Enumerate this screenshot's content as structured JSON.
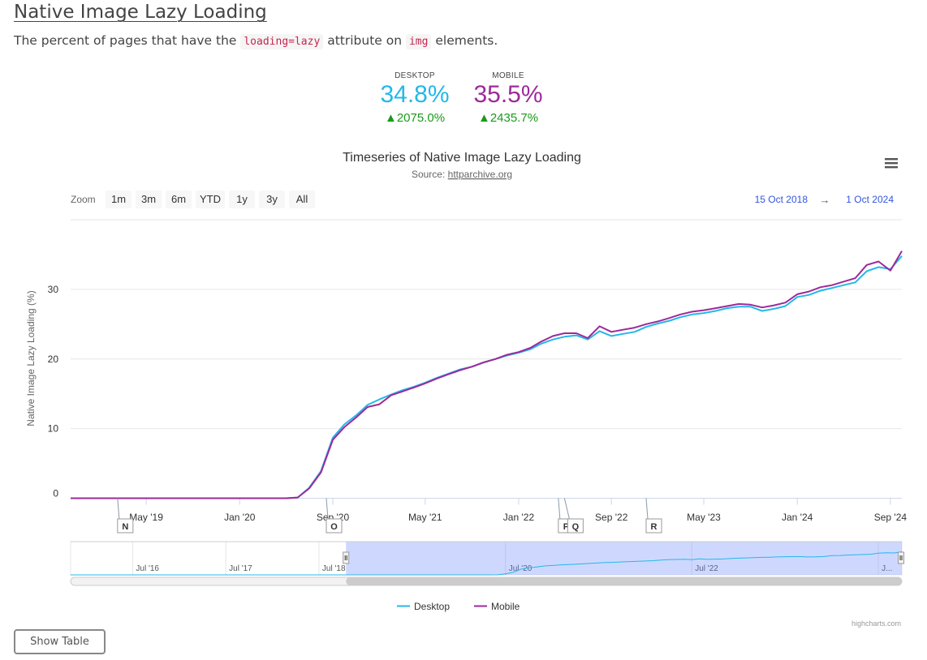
{
  "page": {
    "title": "Native Image Lazy Loading",
    "description_before": "The percent of pages that have the ",
    "description_code1": "loading=lazy",
    "description_middle": " attribute on ",
    "description_code2": "img",
    "description_after": " elements."
  },
  "summary": {
    "desktop": {
      "label": "DESKTOP",
      "value": "34.8%",
      "change": "▲2075.0%",
      "color": "#24b8e8"
    },
    "mobile": {
      "label": "MOBILE",
      "value": "35.5%",
      "change": "▲2435.7%",
      "color": "#9c2a9a"
    }
  },
  "zoom": {
    "label": "Zoom",
    "buttons": [
      "1m",
      "3m",
      "6m",
      "YTD",
      "1y",
      "3y",
      "All"
    ],
    "from": "15 Oct 2018",
    "arrow": "→",
    "to": "1 Oct 2024"
  },
  "menu_icon": "hamburger-menu-icon",
  "show_table_label": "Show Table",
  "credits": "highcharts.com",
  "chart_data": {
    "type": "line",
    "title": "Timeseries of Native Image Lazy Loading",
    "subtitle_prefix": "Source: ",
    "subtitle_link": "httparchive.org",
    "ylabel": "Native Image Lazy Loading (%)",
    "xlabel": "",
    "ylim": [
      0,
      40
    ],
    "xlim": [
      "2018-10-15",
      "2024-10-01"
    ],
    "y_ticks": [
      0,
      10,
      20,
      30
    ],
    "x_ticks": [
      {
        "date": "2019-05-01",
        "label": "May '19"
      },
      {
        "date": "2020-01-01",
        "label": "Jan '20"
      },
      {
        "date": "2020-09-01",
        "label": "Sep '20"
      },
      {
        "date": "2021-05-01",
        "label": "May '21"
      },
      {
        "date": "2022-01-01",
        "label": "Jan '22"
      },
      {
        "date": "2022-09-01",
        "label": "Sep '22"
      },
      {
        "date": "2023-05-01",
        "label": "May '23"
      },
      {
        "date": "2024-01-01",
        "label": "Jan '24"
      },
      {
        "date": "2024-09-01",
        "label": "Sep '24"
      }
    ],
    "grid": true,
    "legend": "bottom-center",
    "flags": [
      {
        "date": "2019-02-15",
        "label": "N"
      },
      {
        "date": "2020-08-15",
        "label": "O"
      },
      {
        "date": "2022-04-15",
        "label": "P"
      },
      {
        "date": "2022-05-01",
        "label": "Q"
      },
      {
        "date": "2022-12-01",
        "label": "R"
      }
    ],
    "navigator": {
      "range": [
        "2015-11-01",
        "2024-10-01"
      ],
      "selected": [
        "2018-10-15",
        "2024-10-01"
      ],
      "labels": [
        {
          "date": "2016-07-01",
          "label": "Jul '16"
        },
        {
          "date": "2017-07-01",
          "label": "Jul '17"
        },
        {
          "date": "2018-07-01",
          "label": "Jul '18"
        },
        {
          "date": "2020-07-01",
          "label": "Jul '20"
        },
        {
          "date": "2022-07-01",
          "label": "Jul '22"
        },
        {
          "date": "2024-07-01",
          "label": "J..."
        }
      ]
    },
    "series": [
      {
        "name": "Desktop",
        "color": "#24b8e8",
        "points": [
          [
            "2018-10-15",
            0
          ],
          [
            "2019-03-01",
            0
          ],
          [
            "2019-08-01",
            0
          ],
          [
            "2020-01-01",
            0
          ],
          [
            "2020-05-01",
            0
          ],
          [
            "2020-06-01",
            0.1
          ],
          [
            "2020-07-01",
            1.5
          ],
          [
            "2020-08-01",
            3.9
          ],
          [
            "2020-09-01",
            8.7
          ],
          [
            "2020-10-01",
            10.6
          ],
          [
            "2020-11-01",
            11.9
          ],
          [
            "2020-12-01",
            13.4
          ],
          [
            "2021-01-01",
            14.2
          ],
          [
            "2021-02-01",
            14.9
          ],
          [
            "2021-03-01",
            15.5
          ],
          [
            "2021-04-01",
            16.0
          ],
          [
            "2021-05-01",
            16.6
          ],
          [
            "2021-06-01",
            17.3
          ],
          [
            "2021-07-01",
            17.9
          ],
          [
            "2021-08-01",
            18.5
          ],
          [
            "2021-09-01",
            18.9
          ],
          [
            "2021-10-01",
            19.5
          ],
          [
            "2021-11-01",
            20.0
          ],
          [
            "2021-12-01",
            20.5
          ],
          [
            "2022-01-01",
            20.9
          ],
          [
            "2022-02-01",
            21.4
          ],
          [
            "2022-03-01",
            22.2
          ],
          [
            "2022-04-01",
            22.8
          ],
          [
            "2022-05-01",
            23.2
          ],
          [
            "2022-06-01",
            23.4
          ],
          [
            "2022-07-01",
            22.8
          ],
          [
            "2022-08-01",
            24.0
          ],
          [
            "2022-09-01",
            23.3
          ],
          [
            "2022-10-01",
            23.6
          ],
          [
            "2022-11-01",
            23.9
          ],
          [
            "2022-12-01",
            24.6
          ],
          [
            "2023-01-01",
            25.1
          ],
          [
            "2023-02-01",
            25.5
          ],
          [
            "2023-03-01",
            26.0
          ],
          [
            "2023-04-01",
            26.4
          ],
          [
            "2023-05-01",
            26.6
          ],
          [
            "2023-06-01",
            26.9
          ],
          [
            "2023-07-01",
            27.3
          ],
          [
            "2023-08-01",
            27.5
          ],
          [
            "2023-09-01",
            27.5
          ],
          [
            "2023-10-01",
            26.9
          ],
          [
            "2023-11-01",
            27.2
          ],
          [
            "2023-12-01",
            27.6
          ],
          [
            "2024-01-01",
            28.9
          ],
          [
            "2024-02-01",
            29.2
          ],
          [
            "2024-03-01",
            29.8
          ],
          [
            "2024-04-01",
            30.2
          ],
          [
            "2024-05-01",
            30.6
          ],
          [
            "2024-06-01",
            31.0
          ],
          [
            "2024-07-01",
            32.6
          ],
          [
            "2024-08-01",
            33.2
          ],
          [
            "2024-09-01",
            32.9
          ],
          [
            "2024-10-01",
            34.8
          ]
        ]
      },
      {
        "name": "Mobile",
        "color": "#9c2a9a",
        "points": [
          [
            "2018-10-15",
            0
          ],
          [
            "2019-03-01",
            0
          ],
          [
            "2019-08-01",
            0
          ],
          [
            "2020-01-01",
            0
          ],
          [
            "2020-05-01",
            0
          ],
          [
            "2020-06-01",
            0.1
          ],
          [
            "2020-07-01",
            1.4
          ],
          [
            "2020-08-01",
            3.7
          ],
          [
            "2020-09-01",
            8.4
          ],
          [
            "2020-10-01",
            10.2
          ],
          [
            "2020-11-01",
            11.6
          ],
          [
            "2020-12-01",
            13.1
          ],
          [
            "2021-01-01",
            13.5
          ],
          [
            "2021-02-01",
            14.8
          ],
          [
            "2021-03-01",
            15.3
          ],
          [
            "2021-04-01",
            15.9
          ],
          [
            "2021-05-01",
            16.5
          ],
          [
            "2021-06-01",
            17.2
          ],
          [
            "2021-07-01",
            17.8
          ],
          [
            "2021-08-01",
            18.4
          ],
          [
            "2021-09-01",
            18.9
          ],
          [
            "2021-10-01",
            19.5
          ],
          [
            "2021-11-01",
            20.0
          ],
          [
            "2021-12-01",
            20.6
          ],
          [
            "2022-01-01",
            21.0
          ],
          [
            "2022-02-01",
            21.6
          ],
          [
            "2022-03-01",
            22.5
          ],
          [
            "2022-04-01",
            23.3
          ],
          [
            "2022-05-01",
            23.7
          ],
          [
            "2022-06-01",
            23.7
          ],
          [
            "2022-07-01",
            23.0
          ],
          [
            "2022-08-01",
            24.7
          ],
          [
            "2022-09-01",
            23.9
          ],
          [
            "2022-10-01",
            24.2
          ],
          [
            "2022-11-01",
            24.5
          ],
          [
            "2022-12-01",
            25.0
          ],
          [
            "2023-01-01",
            25.4
          ],
          [
            "2023-02-01",
            25.9
          ],
          [
            "2023-03-01",
            26.4
          ],
          [
            "2023-04-01",
            26.8
          ],
          [
            "2023-05-01",
            27.0
          ],
          [
            "2023-06-01",
            27.3
          ],
          [
            "2023-07-01",
            27.6
          ],
          [
            "2023-08-01",
            27.9
          ],
          [
            "2023-09-01",
            27.8
          ],
          [
            "2023-10-01",
            27.4
          ],
          [
            "2023-11-01",
            27.7
          ],
          [
            "2023-12-01",
            28.1
          ],
          [
            "2024-01-01",
            29.3
          ],
          [
            "2024-02-01",
            29.7
          ],
          [
            "2024-03-01",
            30.3
          ],
          [
            "2024-04-01",
            30.6
          ],
          [
            "2024-05-01",
            31.1
          ],
          [
            "2024-06-01",
            31.6
          ],
          [
            "2024-07-01",
            33.5
          ],
          [
            "2024-08-01",
            34.0
          ],
          [
            "2024-09-01",
            32.7
          ],
          [
            "2024-10-01",
            35.5
          ]
        ]
      }
    ]
  }
}
